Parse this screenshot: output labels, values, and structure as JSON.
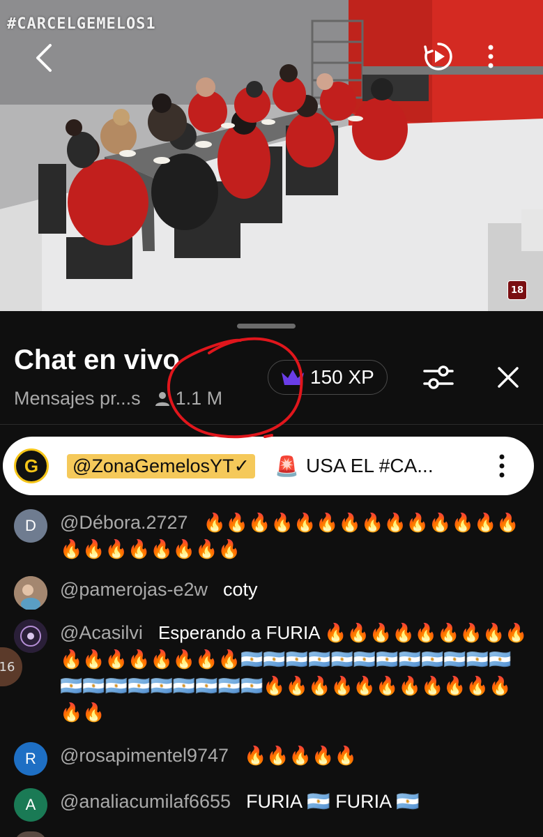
{
  "video": {
    "hashtag": "#CARCELGEMELOS1",
    "age_rating": "18",
    "icons": {
      "back": "chevron-left-icon",
      "autoplay": "autoplay-icon",
      "more": "more-vert-icon"
    }
  },
  "chat": {
    "title": "Chat en vivo",
    "subtitle": "Mensajes pr...s",
    "viewers": "1.1 M",
    "xp": "150 XP",
    "icons": {
      "viewers": "person-icon",
      "xp": "crown-icon",
      "filter": "sliders-icon",
      "close": "close-icon"
    }
  },
  "pinned": {
    "logo_letter": "G",
    "author": "@ZonaGemelosYT✓",
    "siren": "🚨",
    "message": "USA EL #CA..."
  },
  "messages": [
    {
      "avatar_letter": "D",
      "avatar_color": "#6f7c90",
      "author": "@Débora.2727",
      "text": "🔥🔥🔥🔥🔥🔥🔥🔥🔥🔥🔥🔥🔥🔥🔥🔥🔥🔥🔥🔥🔥🔥"
    },
    {
      "avatar_letter": "",
      "avatar_color": "#8a6e5a",
      "author": "@pamerojas-e2w",
      "text": "coty"
    },
    {
      "avatar_letter": "",
      "avatar_color": "#3b2a4a",
      "author": "@Acasilvi",
      "text": "Esperando a FURIA 🔥🔥🔥🔥🔥🔥🔥🔥🔥🔥🔥🔥🔥🔥🔥🔥🔥🇦🇷🇦🇷🇦🇷🇦🇷🇦🇷🇦🇷🇦🇷🇦🇷🇦🇷🇦🇷🇦🇷🇦🇷🇦🇷🇦🇷🇦🇷🇦🇷🇦🇷🇦🇷🇦🇷🇦🇷🇦🇷🔥🔥🔥🔥🔥🔥🔥🔥🔥🔥🔥🔥🔥"
    },
    {
      "avatar_letter": "R",
      "avatar_color": "#1e6fc4",
      "author": "@rosapimentel9747",
      "text": "🔥🔥🔥🔥🔥"
    },
    {
      "avatar_letter": "A",
      "avatar_color": "#1a7a55",
      "author": "@analiacumilaf6655",
      "text": "FURIA 🇦🇷 FURIA 🇦🇷"
    }
  ],
  "side_bubble": "16"
}
